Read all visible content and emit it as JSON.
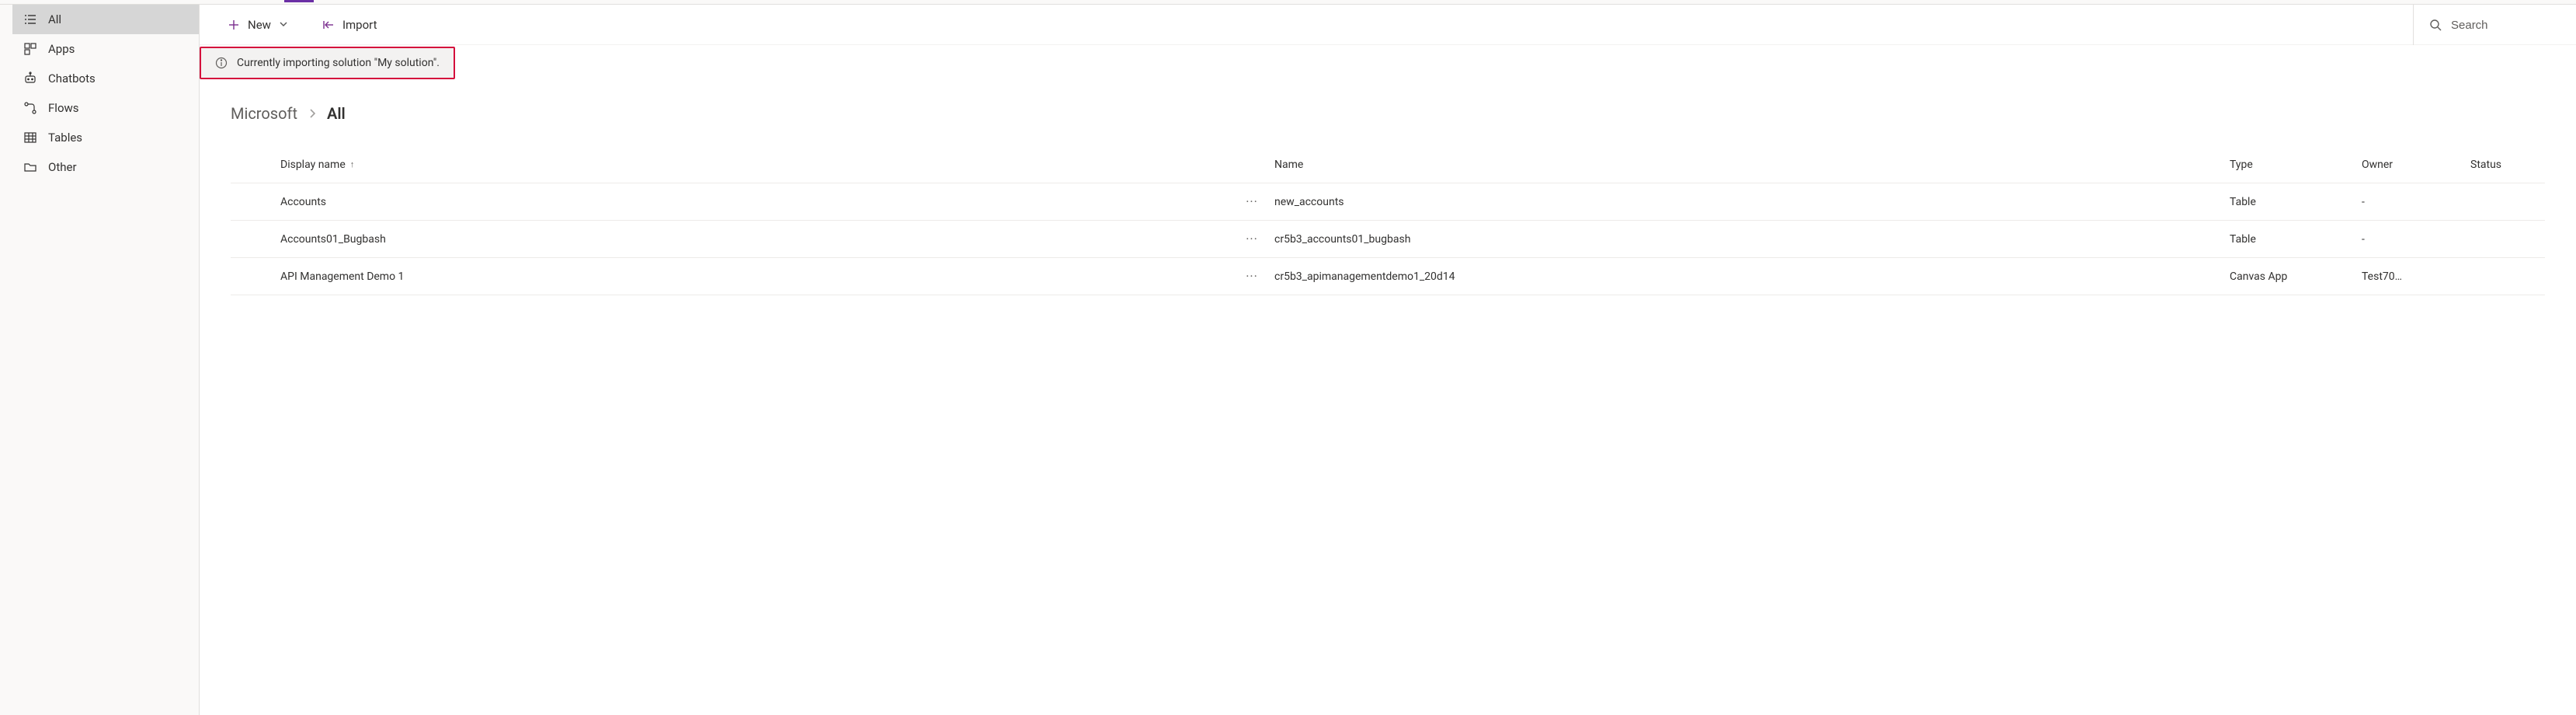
{
  "colors": {
    "accent": "#7a2f8e",
    "alert": "#d40f3c"
  },
  "sidebar": {
    "items": [
      {
        "label": "All",
        "icon": "list-icon",
        "active": true,
        "expandable": false
      },
      {
        "label": "Apps",
        "icon": "apps-icon",
        "active": false,
        "expandable": false
      },
      {
        "label": "Chatbots",
        "icon": "bot-icon",
        "active": false,
        "expandable": false
      },
      {
        "label": "Flows",
        "icon": "flow-icon",
        "active": false,
        "expandable": false
      },
      {
        "label": "Tables",
        "icon": "table-icon",
        "active": false,
        "expandable": true
      },
      {
        "label": "Other",
        "icon": "folder-icon",
        "active": false,
        "expandable": true
      }
    ]
  },
  "commandBar": {
    "new_label": "New",
    "import_label": "Import",
    "search_placeholder": "Search"
  },
  "notification": {
    "text": "Currently importing solution \"My solution\"."
  },
  "breadcrumb": {
    "root": "Microsoft",
    "current": "All"
  },
  "table": {
    "columns": {
      "display_name": "Display name",
      "name": "Name",
      "type": "Type",
      "owner": "Owner",
      "status": "Status"
    },
    "sort_indicator": "↑",
    "rows": [
      {
        "display_name": "Accounts",
        "name": "new_accounts",
        "type": "Table",
        "owner": "-",
        "status": ""
      },
      {
        "display_name": "Accounts01_Bugbash",
        "name": "cr5b3_accounts01_bugbash",
        "type": "Table",
        "owner": "-",
        "status": ""
      },
      {
        "display_name": "API Management Demo 1",
        "name": "cr5b3_apimanagementdemo1_20d14",
        "type": "Canvas App",
        "owner": "Test70…",
        "status": ""
      }
    ]
  }
}
